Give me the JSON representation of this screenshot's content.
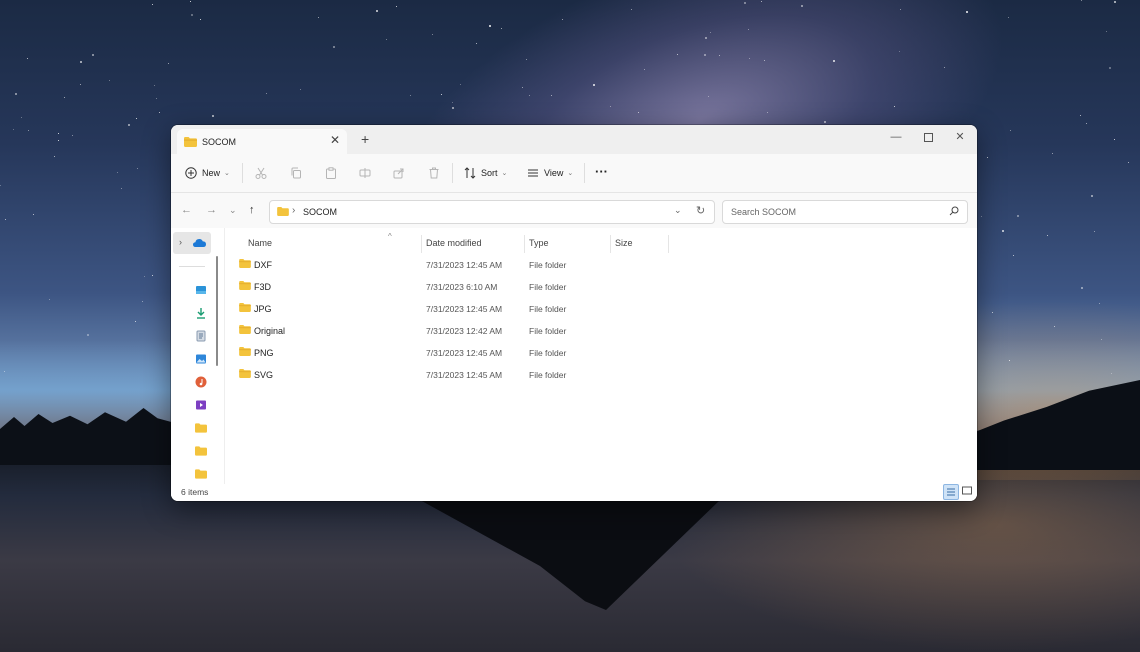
{
  "window": {
    "tab_title": "SOCOM",
    "new_tab_glyph": "+",
    "close_tab_glyph": "✕",
    "controls": {
      "minimize": "—",
      "close": "✕"
    }
  },
  "toolbar": {
    "new_label": "New",
    "sort_label": "Sort",
    "view_label": "View",
    "more_glyph": "···",
    "chevron": "⌄"
  },
  "address_bar": {
    "separator": "›",
    "path": "SOCOM",
    "search_placeholder": "Search SOCOM"
  },
  "columns": {
    "name": "Name",
    "date_modified": "Date modified",
    "type": "Type",
    "size": "Size"
  },
  "files": [
    {
      "name": "DXF",
      "date_modified": "7/31/2023 12:45 AM",
      "type": "File folder"
    },
    {
      "name": "F3D",
      "date_modified": "7/31/2023 6:10 AM",
      "type": "File folder"
    },
    {
      "name": "JPG",
      "date_modified": "7/31/2023 12:45 AM",
      "type": "File folder"
    },
    {
      "name": "Original",
      "date_modified": "7/31/2023 12:42 AM",
      "type": "File folder"
    },
    {
      "name": "PNG",
      "date_modified": "7/31/2023 12:45 AM",
      "type": "File folder"
    },
    {
      "name": "SVG",
      "date_modified": "7/31/2023 12:45 AM",
      "type": "File folder"
    }
  ],
  "status": {
    "item_count": "6 items"
  },
  "nav_pane": {
    "icons": [
      "onedrive-icon",
      "desktop-icon",
      "downloads-icon",
      "documents-icon",
      "pictures-icon",
      "music-icon",
      "videos-icon",
      "folder-icon",
      "folder-icon",
      "folder-icon"
    ]
  },
  "colors": {
    "folder": "#f3c33c",
    "accent": "#0067c0",
    "titlebar": "#efefef",
    "toolbar": "#f9f9f9"
  }
}
